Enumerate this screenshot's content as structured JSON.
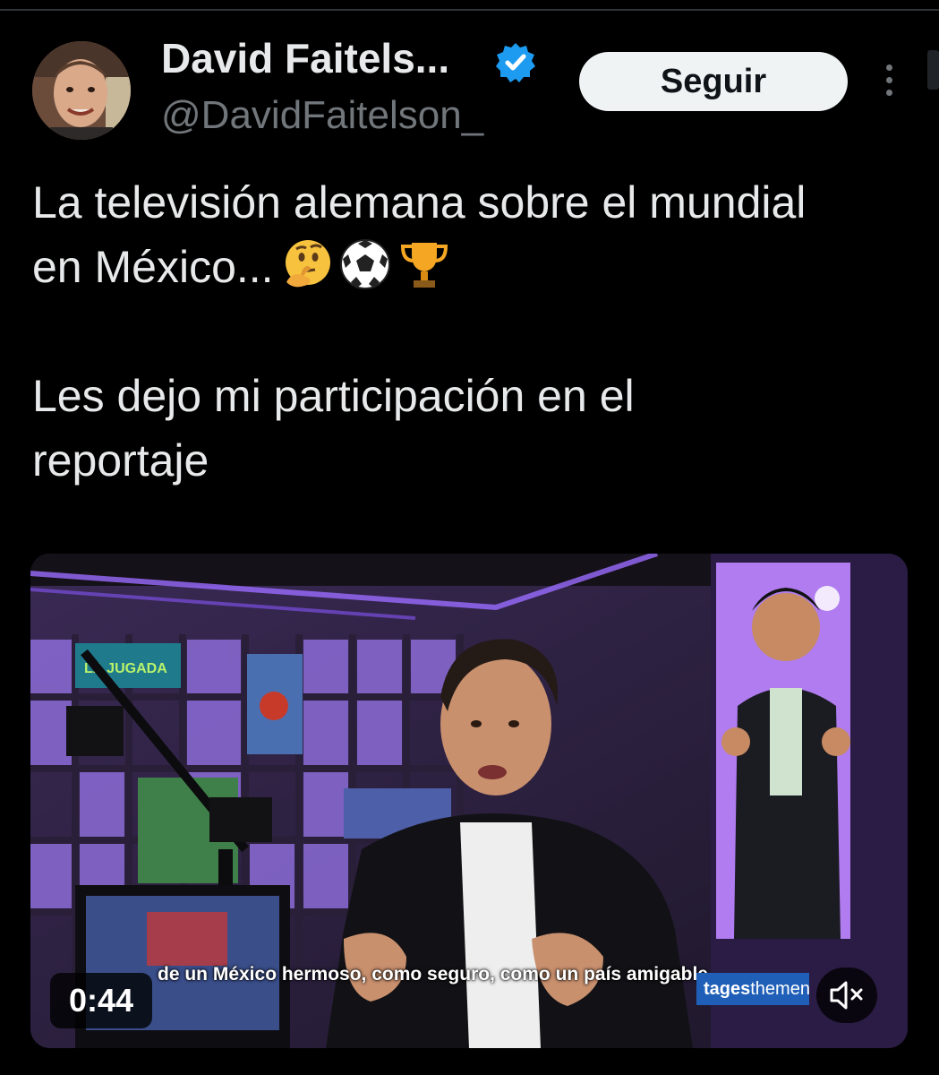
{
  "author": {
    "display_name": "David Faitels...",
    "handle": "@DavidFaitelson_",
    "verified": true
  },
  "follow_label": "Seguir",
  "tweet": {
    "paragraph1": "La televisión alemana sobre el mundial en México...",
    "paragraph1_emojis": [
      "thinking-face",
      "soccer-ball",
      "trophy"
    ],
    "paragraph2": "Les dejo mi participación en el reportaje"
  },
  "video": {
    "duration": "0:44",
    "caption": "de un México hermoso, como seguro, como un país amigable",
    "broadcaster_tag_bold": "tages",
    "broadcaster_tag_rest": "themen",
    "set_sign": "LA JUGADA"
  },
  "icons": [
    "verified-badge-icon",
    "more-options-icon",
    "mute-icon"
  ],
  "colors": {
    "background": "#000000",
    "text": "#e7e9ea",
    "secondary_text": "#71767b",
    "verified": "#1d9bf0",
    "button_bg": "#eff3f4"
  }
}
